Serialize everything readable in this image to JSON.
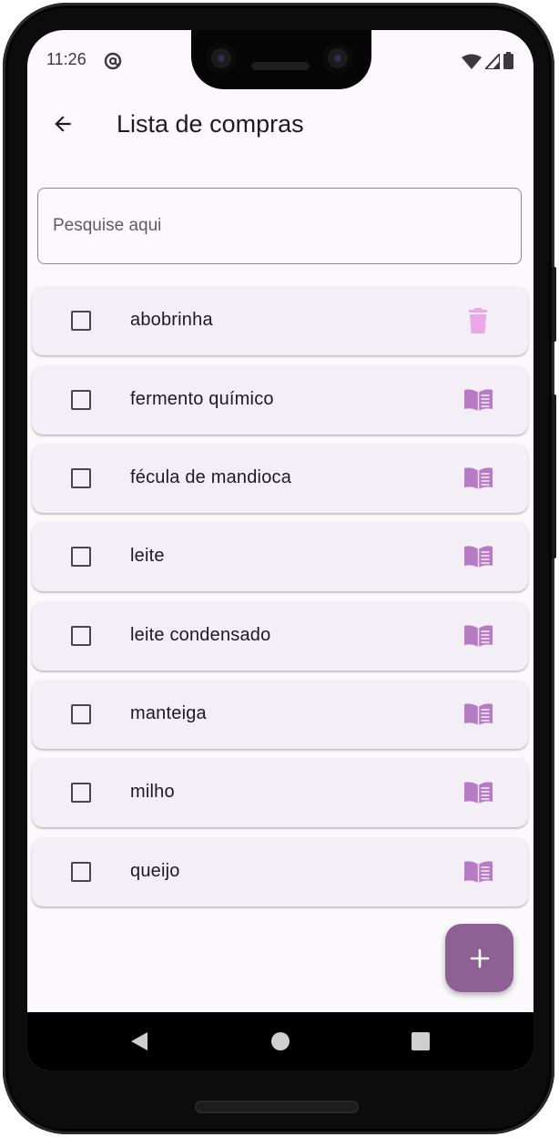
{
  "status_bar": {
    "time": "11:26",
    "icons": [
      "at-sign-icon",
      "wifi-icon",
      "signal-icon",
      "battery-icon"
    ]
  },
  "app_bar": {
    "title": "Lista de compras",
    "back_icon": "arrow-back-icon"
  },
  "search": {
    "placeholder": "Pesquise aqui",
    "value": ""
  },
  "items": [
    {
      "label": "abobrinha",
      "checked": false,
      "action_icon": "trash-icon"
    },
    {
      "label": "fermento químico",
      "checked": false,
      "action_icon": "book-icon"
    },
    {
      "label": "fécula de mandioca",
      "checked": false,
      "action_icon": "book-icon"
    },
    {
      "label": "leite",
      "checked": false,
      "action_icon": "book-icon"
    },
    {
      "label": "leite condensado",
      "checked": false,
      "action_icon": "book-icon"
    },
    {
      "label": "manteiga",
      "checked": false,
      "action_icon": "book-icon"
    },
    {
      "label": "milho",
      "checked": false,
      "action_icon": "book-icon"
    },
    {
      "label": "queijo",
      "checked": false,
      "action_icon": "book-icon"
    }
  ],
  "fab": {
    "icon": "plus-icon"
  },
  "nav_bar": {
    "icons": [
      "nav-back-icon",
      "nav-home-icon",
      "nav-recents-icon"
    ]
  },
  "colors": {
    "item_background": "#f4eff6",
    "icon_accent": "#b57cc3",
    "trash_accent": "#eaa8e6",
    "fab_background": "#8d6193",
    "screen_background": "#fbf9fb"
  }
}
